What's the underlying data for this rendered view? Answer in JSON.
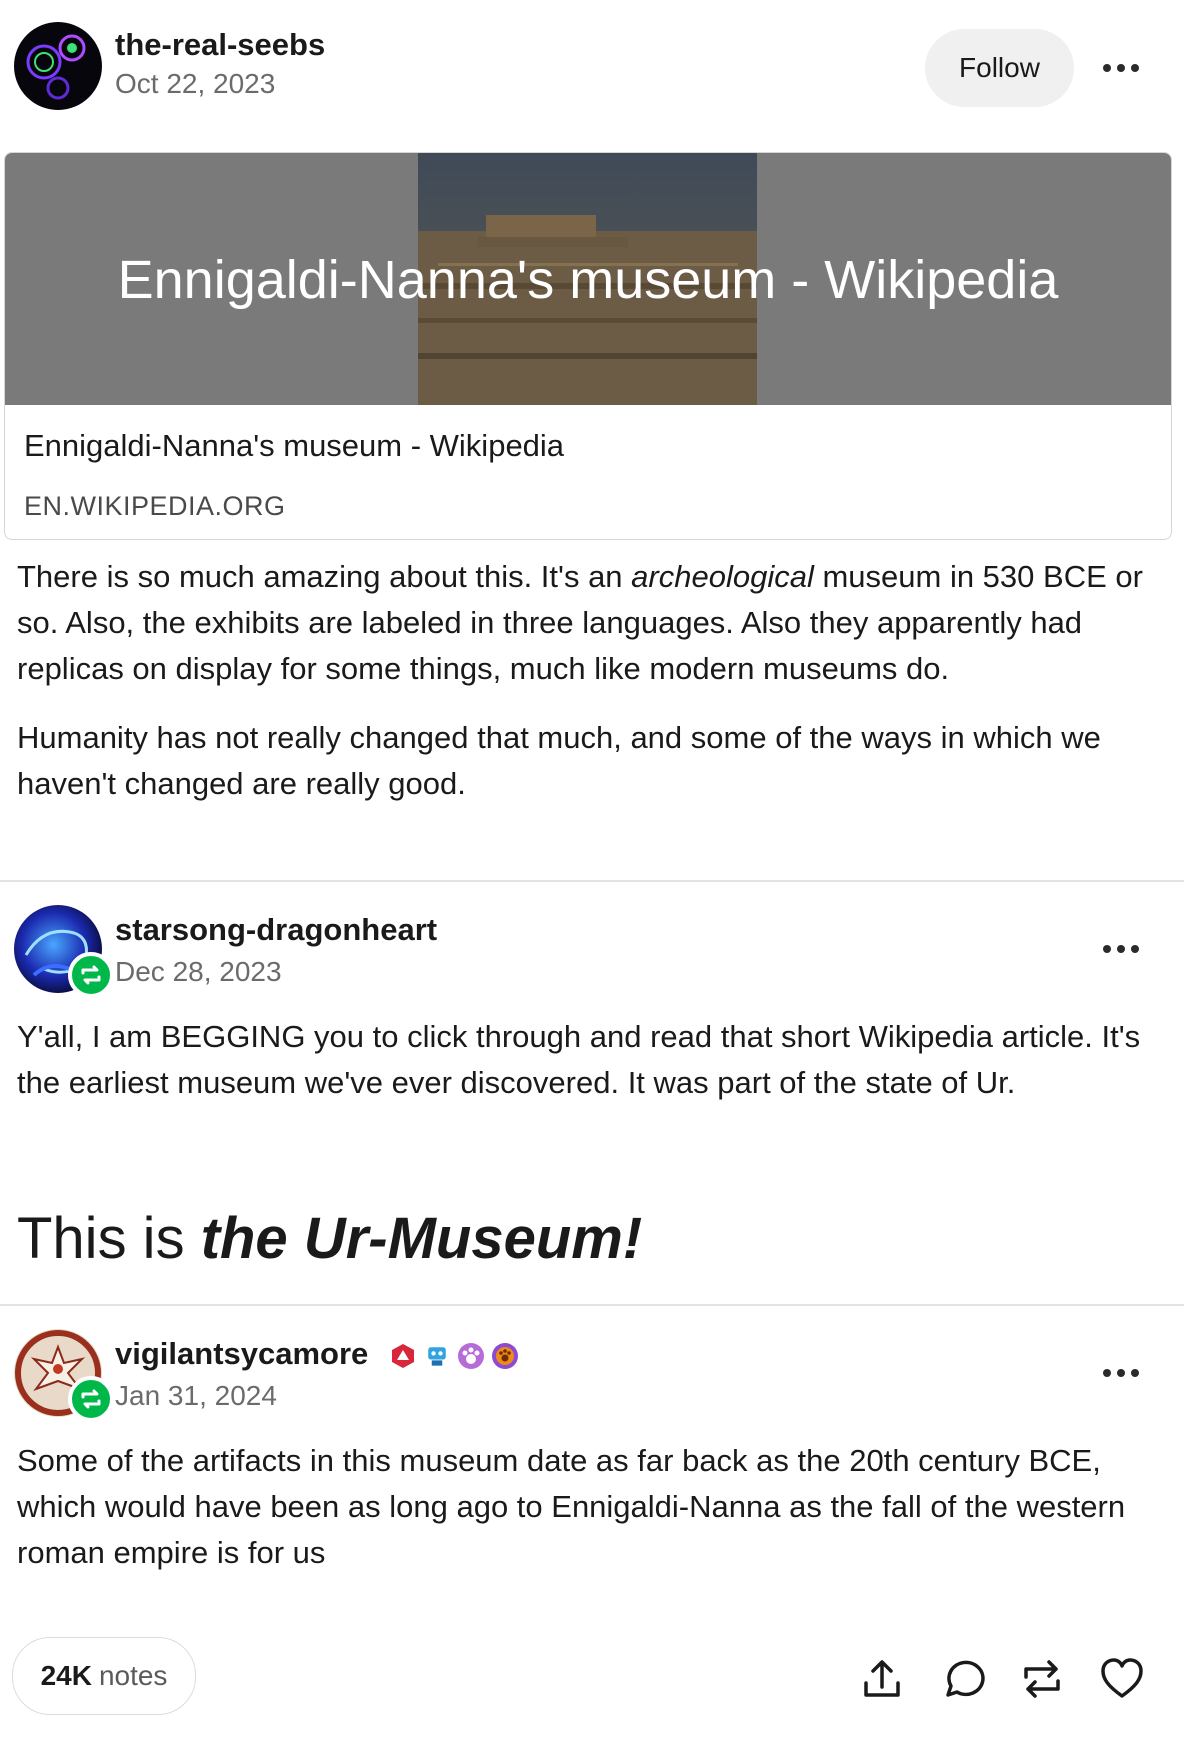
{
  "posts": [
    {
      "username": "the-real-seebs",
      "date": "Oct 22, 2023",
      "follow_label": "Follow",
      "link": {
        "hero_title": "Ennigaldi-Nanna's museum - Wikipedia",
        "title": "Ennigaldi-Nanna's museum - Wikipedia",
        "domain": "EN.WIKIPEDIA.ORG"
      },
      "paragraph1_part1": "There is so much amazing about this. It's an ",
      "paragraph1_em": "archeological",
      "paragraph1_part2": " museum in 530 BCE or so. Also, the exhibits are labeled in three languages. Also they apparently had replicas on display for some things, much like modern museums do.",
      "paragraph2": "Humanity has not really changed that much, and some of the ways in which we haven't changed are really good."
    },
    {
      "username": "starsong-dragonheart",
      "date": "Dec 28, 2023",
      "paragraph1": "Y'all, I am BEGGING you to click through and read that short Wikipedia article. It's the earliest museum we've ever discovered. It was part of the state of Ur.",
      "headline_plain": "This is ",
      "headline_em": "the Ur-Museum!"
    },
    {
      "username": "vigilantsycamore",
      "date": "Jan 31, 2024",
      "badge_icons": [
        "red-d20-badge",
        "blue-robot-badge",
        "purple-paw-badge",
        "orange-paw-badge"
      ],
      "paragraph1": "Some of the artifacts in this museum date as far back as the 20th century BCE, which would have been as long ago to Ennigaldi-Nanna as the fall of the western roman empire is for us"
    }
  ],
  "footer": {
    "notes_count": "24K",
    "notes_label": "notes",
    "actions": [
      "share-icon",
      "reply-icon",
      "reblog-icon",
      "like-icon"
    ]
  },
  "colors": {
    "reblog_green": "#00b84a",
    "muted_text": "#6b6b6b",
    "follow_bg": "#f0f0f0"
  }
}
